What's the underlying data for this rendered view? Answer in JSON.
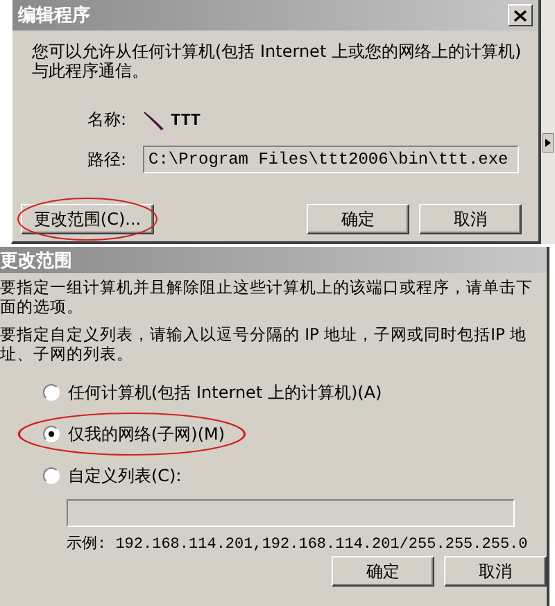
{
  "edit_dialog": {
    "title": "编辑程序",
    "description": "您可以允许从任何计算机(包括 Internet 上或您的网络上的计算机)与此程序通信。",
    "name_label": "名称:",
    "name_value": "TTT",
    "path_label": "路径:",
    "path_value": "C:\\Program Files\\ttt2006\\bin\\ttt.exe",
    "scope_button": {
      "label": "更改范围(C)...",
      "highlighted": true
    },
    "buttons": [
      "确定",
      "取消"
    ]
  },
  "scope_dialog": {
    "title": "更改范围",
    "paragraphs": [
      "要指定一组计算机并且解除阻止这些计算机上的该端口或程序，请单击下面的选项。",
      "要指定自定义列表，请输入以逗号分隔的 IP 地址，子网或同时包括IP 地址、子网的列表。"
    ],
    "options": [
      {
        "label": "任何计算机(包括 Internet 上的计算机)(A)",
        "selected": false,
        "highlighted": false
      },
      {
        "label": "仅我的网络(子网)(M)",
        "selected": true,
        "highlighted": true
      },
      {
        "label": "自定义列表(C):",
        "selected": false,
        "highlighted": false
      }
    ],
    "example": "示例: 192.168.114.201,192.168.114.201/255.255.255.0",
    "buttons": [
      "确定",
      "取消"
    ]
  }
}
